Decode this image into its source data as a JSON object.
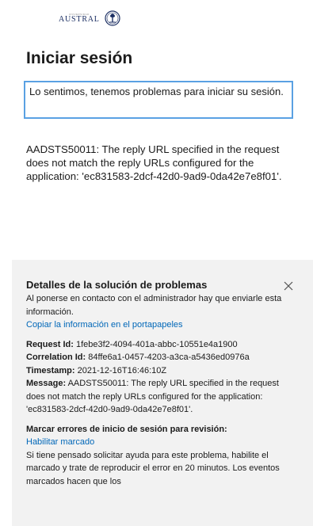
{
  "logo": {
    "small_text": "UNIVERSIDAD",
    "name": "AUSTRAL"
  },
  "page": {
    "title": "Iniciar sesión",
    "alert": "Lo sentimos, tenemos problemas para iniciar su sesión.",
    "error_message": "AADSTS50011: The reply URL specified in the request does not match the reply URLs configured for the application: 'ec831583-2dcf-42d0-9ad9-0da42e7e8f01'."
  },
  "details": {
    "title": "Detalles de la solución de problemas",
    "intro": "Al ponerse en contacto con el administrador hay que enviarle esta información.",
    "copy_link": "Copiar la información en el portapapeles",
    "request_id_label": "Request Id:",
    "request_id_value": " 1febe3f2-4094-401a-abbc-10551e4a1900",
    "correlation_id_label": "Correlation Id:",
    "correlation_id_value": " 84ffe6a1-0457-4203-a3ca-a5436ed0976a",
    "timestamp_label": "Timestamp:",
    "timestamp_value": " 2021-12-16T16:46:10Z",
    "message_label": "Message:",
    "message_value": " AADSTS50011: The reply URL specified in the request does not match the reply URLs configured for the application: 'ec831583-2dcf-42d0-9ad9-0da42e7e8f01'.",
    "flag_title": "Marcar errores de inicio de sesión para revisión:",
    "flag_link": "Habilitar marcado",
    "flag_text": "Si tiene pensado solicitar ayuda para este problema, habilite el marcado y trate de reproducir el error en 20 minutos. Los eventos marcados hacen que los"
  },
  "colors": {
    "accent_border": "#5aa1e3",
    "link": "#0067b8",
    "panel_bg": "#f2f2f2"
  },
  "icons": {
    "logo": "austral-emblem-icon",
    "close": "close-icon"
  }
}
